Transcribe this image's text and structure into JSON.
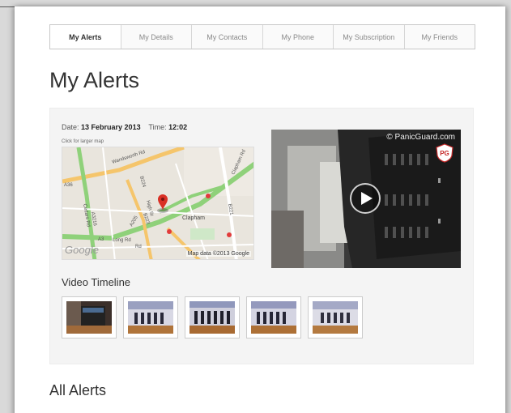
{
  "tabs": [
    {
      "label": "My Alerts",
      "active": true
    },
    {
      "label": "My Details",
      "active": false
    },
    {
      "label": "My Contacts",
      "active": false
    },
    {
      "label": "My Phone",
      "active": false
    },
    {
      "label": "My Subscription",
      "active": false
    },
    {
      "label": "My Friends",
      "active": false
    }
  ],
  "page_title": "My Alerts",
  "alert": {
    "date_label": "Date:",
    "date_value": "13 February 2013",
    "time_label": "Time:",
    "time_value": "12:02",
    "map_hint": "Click for larger map",
    "map_logo": "Google",
    "map_credit": "Map data ©2013 Google",
    "map_labels": [
      "Wandsworth Rd",
      "A36",
      "Cedars Rd",
      "A3216",
      "B224",
      "Clapham",
      "A3",
      "Long Rd",
      "A205",
      "B223",
      "B221",
      "Clapham Rd",
      "Rd",
      "High St"
    ],
    "video_credit": "© PanicGuard.com",
    "video_badge": "PG",
    "play_icon": "play-icon",
    "marker_icon": "map-marker-icon"
  },
  "timeline": {
    "heading": "Video Timeline",
    "thumb_count": 5
  },
  "all_alerts": {
    "title": "All Alerts"
  },
  "colors": {
    "accent_road": "#f5c56b",
    "green_road": "#8fd17a",
    "marker": "#d93025",
    "panel_bg": "#f4f4f4"
  }
}
